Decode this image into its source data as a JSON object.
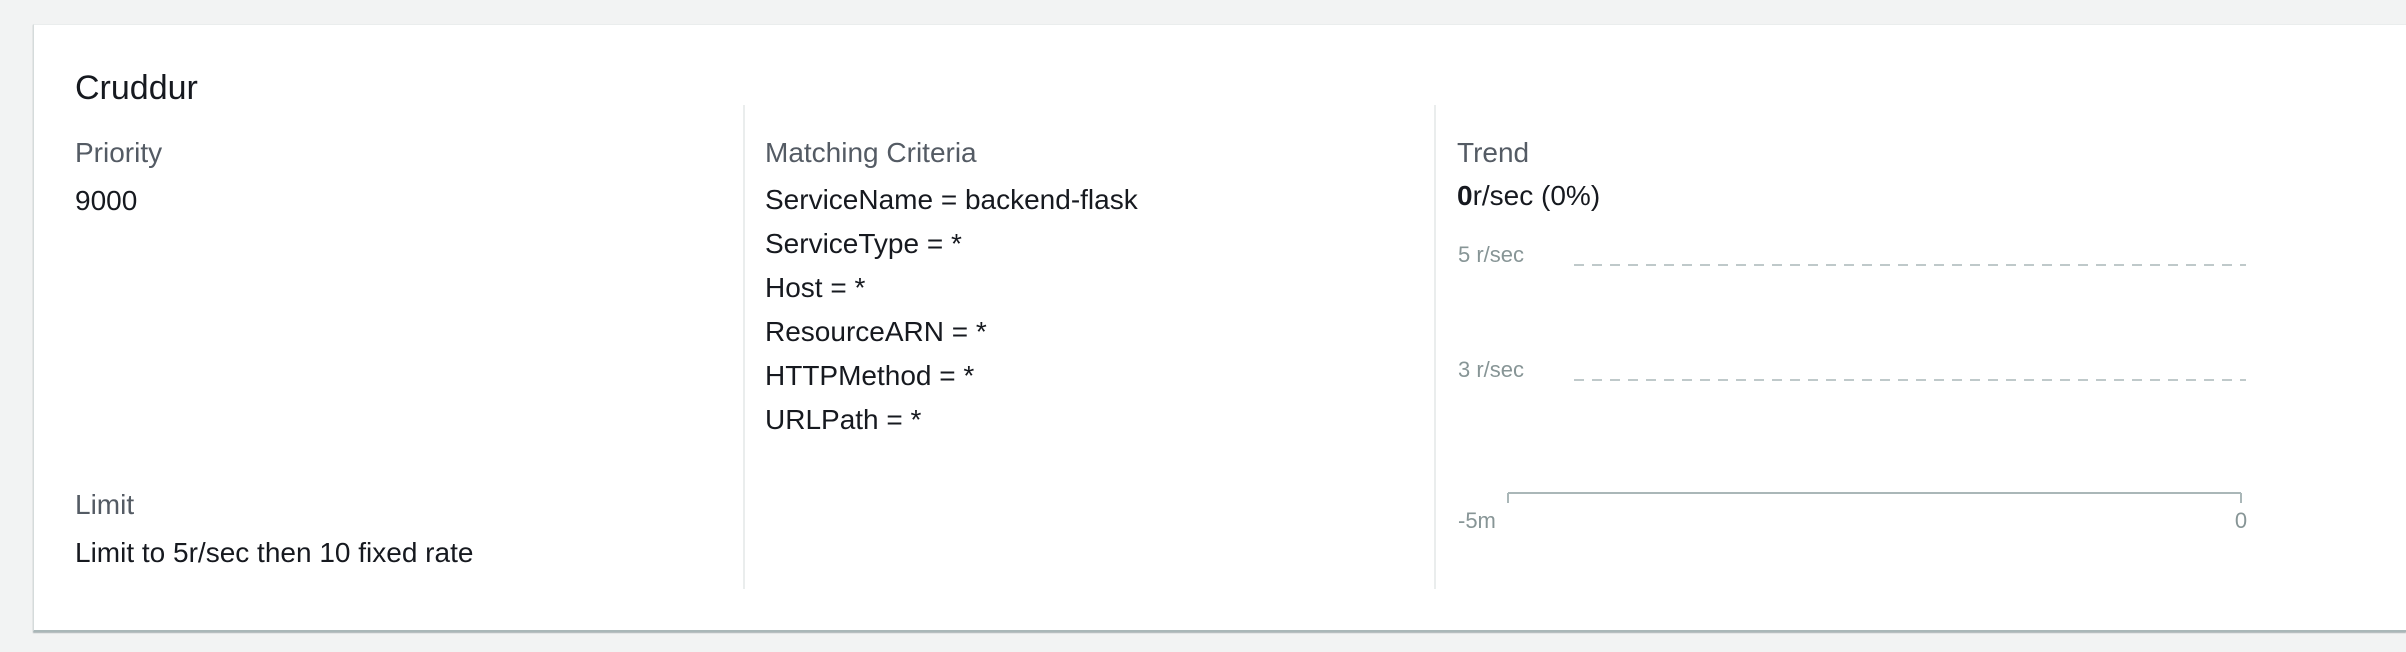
{
  "rule": {
    "title": "Cruddur",
    "priority": {
      "label": "Priority",
      "value": "9000"
    },
    "limit": {
      "label": "Limit",
      "value": "Limit to 5r/sec then 10 fixed rate"
    },
    "matching_criteria": {
      "label": "Matching Criteria",
      "items": [
        "ServiceName = backend-flask",
        "ServiceType = *",
        "Host = *",
        "ResourceARN = *",
        "HTTPMethod = *",
        "URLPath = *"
      ]
    },
    "trend": {
      "label": "Trend",
      "current_number": "0",
      "current_suffix": "r/sec (0%)"
    }
  },
  "chart_data": {
    "type": "line",
    "title": "",
    "xlabel": "",
    "ylabel": "",
    "x_ticks": [
      "-5m",
      "0"
    ],
    "y_ticks": [
      "5 r/sec",
      "3 r/sec"
    ],
    "y_tick_values": [
      5,
      3
    ],
    "series": [],
    "grid": true,
    "grid_style": "dashed",
    "colors": {
      "grid": "#aab7b8",
      "tick_text": "#879596",
      "axis": "#aab7b8"
    }
  }
}
